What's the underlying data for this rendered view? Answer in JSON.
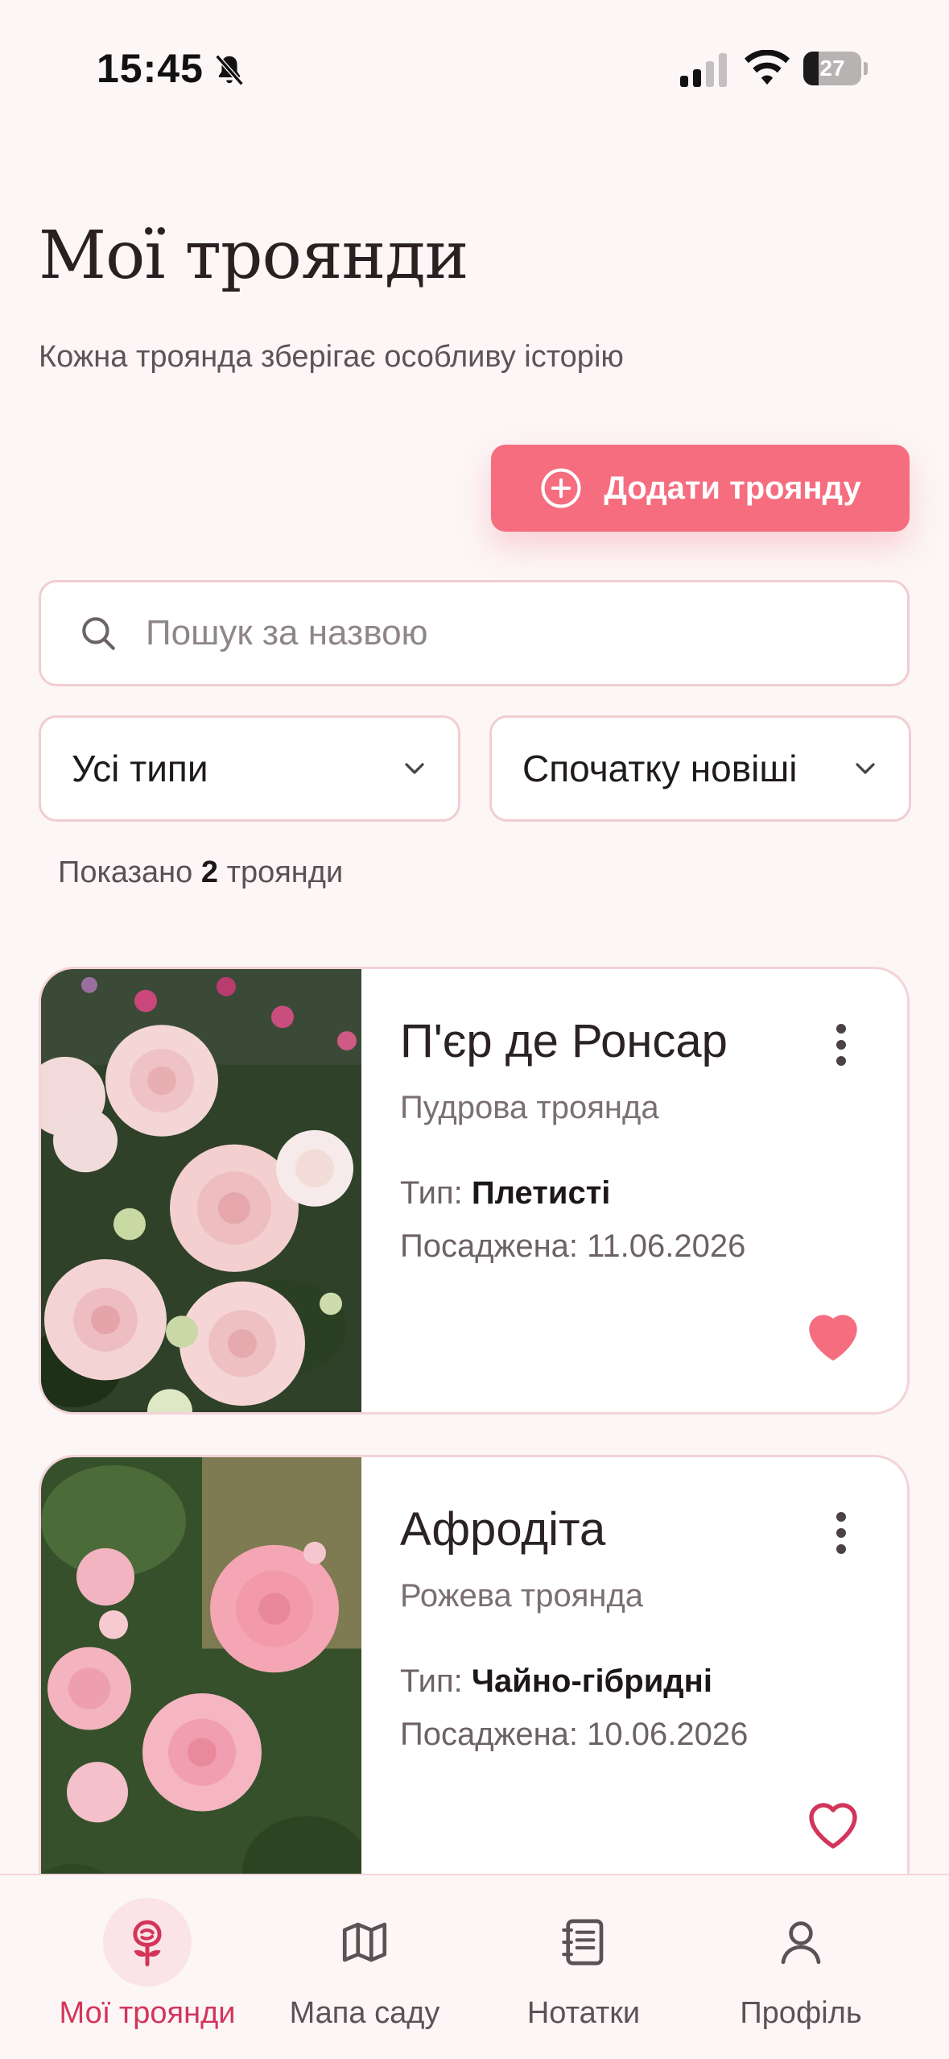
{
  "status_bar": {
    "time": "15:45",
    "battery_level": 27,
    "battery_text": "27"
  },
  "header": {
    "title": "Мої троянди",
    "subtitle": "Кожна троянда зберігає особливу історію"
  },
  "add_button": {
    "label": "Додати троянду",
    "icon": "plus-circle-icon"
  },
  "search": {
    "placeholder": "Пошук за назвою",
    "value": ""
  },
  "filters": {
    "type_selected": "Усі типи",
    "sort_selected": "Спочатку новіші"
  },
  "result": {
    "prefix": "Показано",
    "count": "2",
    "suffix": "троянди"
  },
  "roses": [
    {
      "name": "П'єр де Ронсар",
      "variety": "Пудрова троянда",
      "type_label": "Тип:",
      "type_value": "Плетисті",
      "planted": "Посаджена: 11.06.2026",
      "favorite": true
    },
    {
      "name": "Афродіта",
      "variety": "Рожева троянда",
      "type_label": "Тип:",
      "type_value": "Чайно-гібридні",
      "planted": "Посаджена: 10.06.2026",
      "favorite": false
    }
  ],
  "nav": {
    "items": [
      {
        "label": "Мої троянди",
        "icon": "rose-icon",
        "active": true
      },
      {
        "label": "Мапа саду",
        "icon": "map-icon",
        "active": false
      },
      {
        "label": "Нотатки",
        "icon": "notebook-icon",
        "active": false
      },
      {
        "label": "Профіль",
        "icon": "user-icon",
        "active": false
      }
    ]
  },
  "colors": {
    "accent": "#f56d7f",
    "active_nav": "#d3355a",
    "background": "#fcf6f6",
    "border": "#f1cdd2"
  }
}
